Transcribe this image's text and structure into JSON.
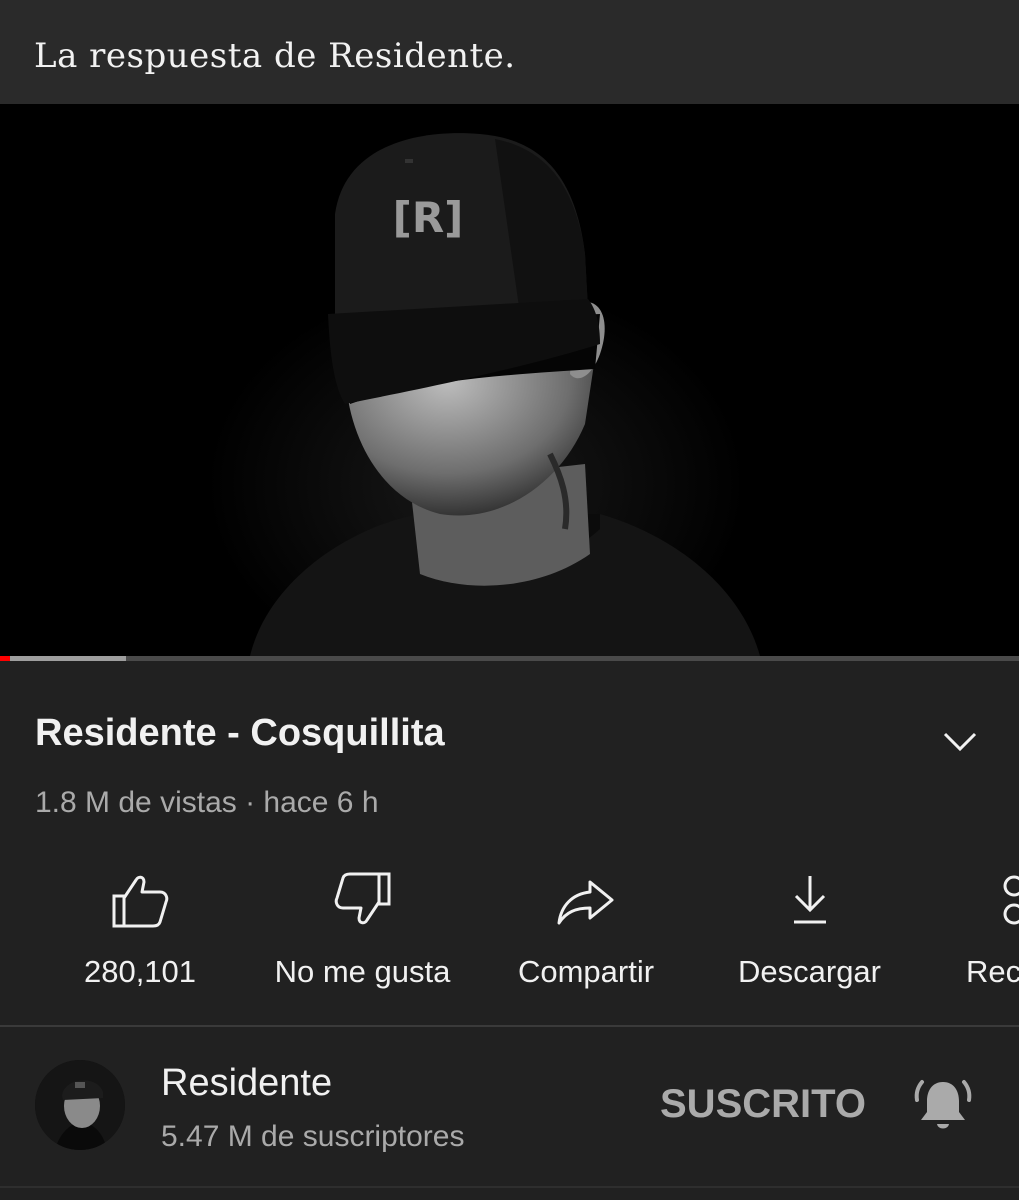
{
  "caption": "La respuesta de Residente.",
  "video": {
    "cap_logo": "[R]",
    "progress_played": 0.01,
    "progress_buffered": 0.124
  },
  "title": "Residente - Cosquillita",
  "meta": "1.8 M de vistas · hace 6 h",
  "actions": {
    "like": {
      "label": "280,101",
      "icon": "thumbs-up-icon"
    },
    "dislike": {
      "label": "No me gusta",
      "icon": "thumbs-down-icon"
    },
    "share": {
      "label": "Compartir",
      "icon": "share-icon"
    },
    "download": {
      "label": "Descargar",
      "icon": "download-icon"
    },
    "save": {
      "label": "Rec",
      "icon": "save-icon"
    }
  },
  "channel": {
    "name": "Residente",
    "subscribers": "5.47 M de suscriptores",
    "subscribe_state": "SUSCRITO",
    "bell_icon": "bell-icon"
  },
  "colors": {
    "background": "#212121",
    "progress_red": "#ff0000",
    "secondary_text": "#aaaaaa"
  }
}
